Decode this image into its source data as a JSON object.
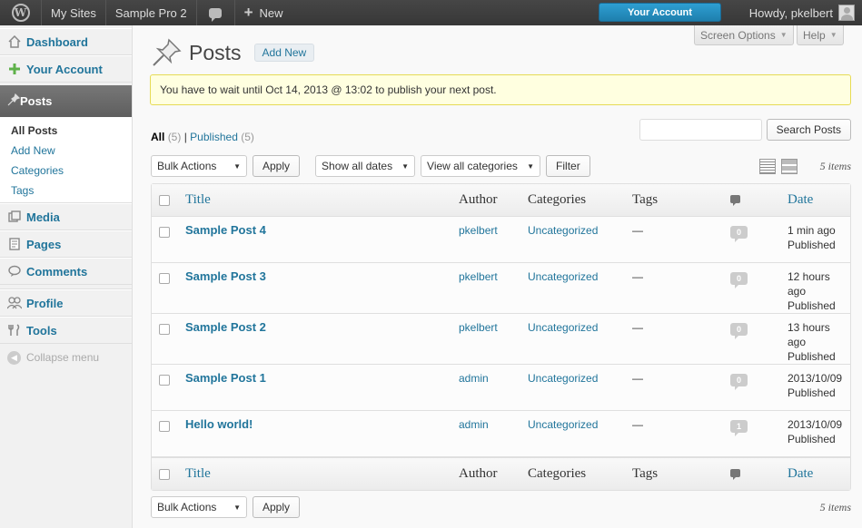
{
  "adminbar": {
    "my_sites": "My Sites",
    "site_name": "Sample Pro 2",
    "new_label": "New",
    "your_account": "Your Account",
    "howdy": "Howdy, pkelbert"
  },
  "sidebar": {
    "items": [
      {
        "label": "Dashboard",
        "icon": "dashboard-icon"
      },
      {
        "label": "Your Account",
        "icon": "plus-icon"
      }
    ],
    "current": {
      "label": "Posts",
      "icon": "pin-icon"
    },
    "submenu": [
      "All Posts",
      "Add New",
      "Categories",
      "Tags"
    ],
    "items2": [
      {
        "label": "Media",
        "icon": "media-icon"
      },
      {
        "label": "Pages",
        "icon": "pages-icon"
      },
      {
        "label": "Comments",
        "icon": "comments-icon"
      }
    ],
    "items3": [
      {
        "label": "Profile",
        "icon": "profile-icon"
      },
      {
        "label": "Tools",
        "icon": "tools-icon"
      }
    ],
    "collapse": "Collapse menu"
  },
  "screen_options": "Screen Options",
  "help": "Help",
  "page": {
    "title": "Posts",
    "add_new": "Add New",
    "notice": "You have to wait until Oct 14, 2013 @ 13:02 to publish your next post."
  },
  "filters": {
    "all": "All",
    "all_count": "(5)",
    "sep": "|",
    "published": "Published",
    "published_count": "(5)"
  },
  "search": {
    "button": "Search Posts",
    "value": ""
  },
  "tablenav": {
    "bulk_actions": "Bulk Actions",
    "apply": "Apply",
    "dates": "Show all dates",
    "categories": "View all categories",
    "filter": "Filter",
    "items": "5 items"
  },
  "table": {
    "columns": {
      "title": "Title",
      "author": "Author",
      "categories": "Categories",
      "tags": "Tags",
      "date": "Date"
    },
    "rows": [
      {
        "title": "Sample Post 4",
        "author": "pkelbert",
        "category": "Uncategorized",
        "tags": "—",
        "comments": "0",
        "date": [
          "1 min ago",
          "Published"
        ]
      },
      {
        "title": "Sample Post 3",
        "author": "pkelbert",
        "category": "Uncategorized",
        "tags": "—",
        "comments": "0",
        "date": [
          "12 hours",
          "ago",
          "Published"
        ]
      },
      {
        "title": "Sample Post 2",
        "author": "pkelbert",
        "category": "Uncategorized",
        "tags": "—",
        "comments": "0",
        "date": [
          "13 hours",
          "ago",
          "Published"
        ]
      },
      {
        "title": "Sample Post 1",
        "author": "admin",
        "category": "Uncategorized",
        "tags": "—",
        "comments": "0",
        "date": [
          "2013/10/09",
          "Published"
        ]
      },
      {
        "title": "Hello world!",
        "author": "admin",
        "category": "Uncategorized",
        "tags": "—",
        "comments": "1",
        "date": [
          "2013/10/09",
          "Published"
        ]
      }
    ]
  }
}
